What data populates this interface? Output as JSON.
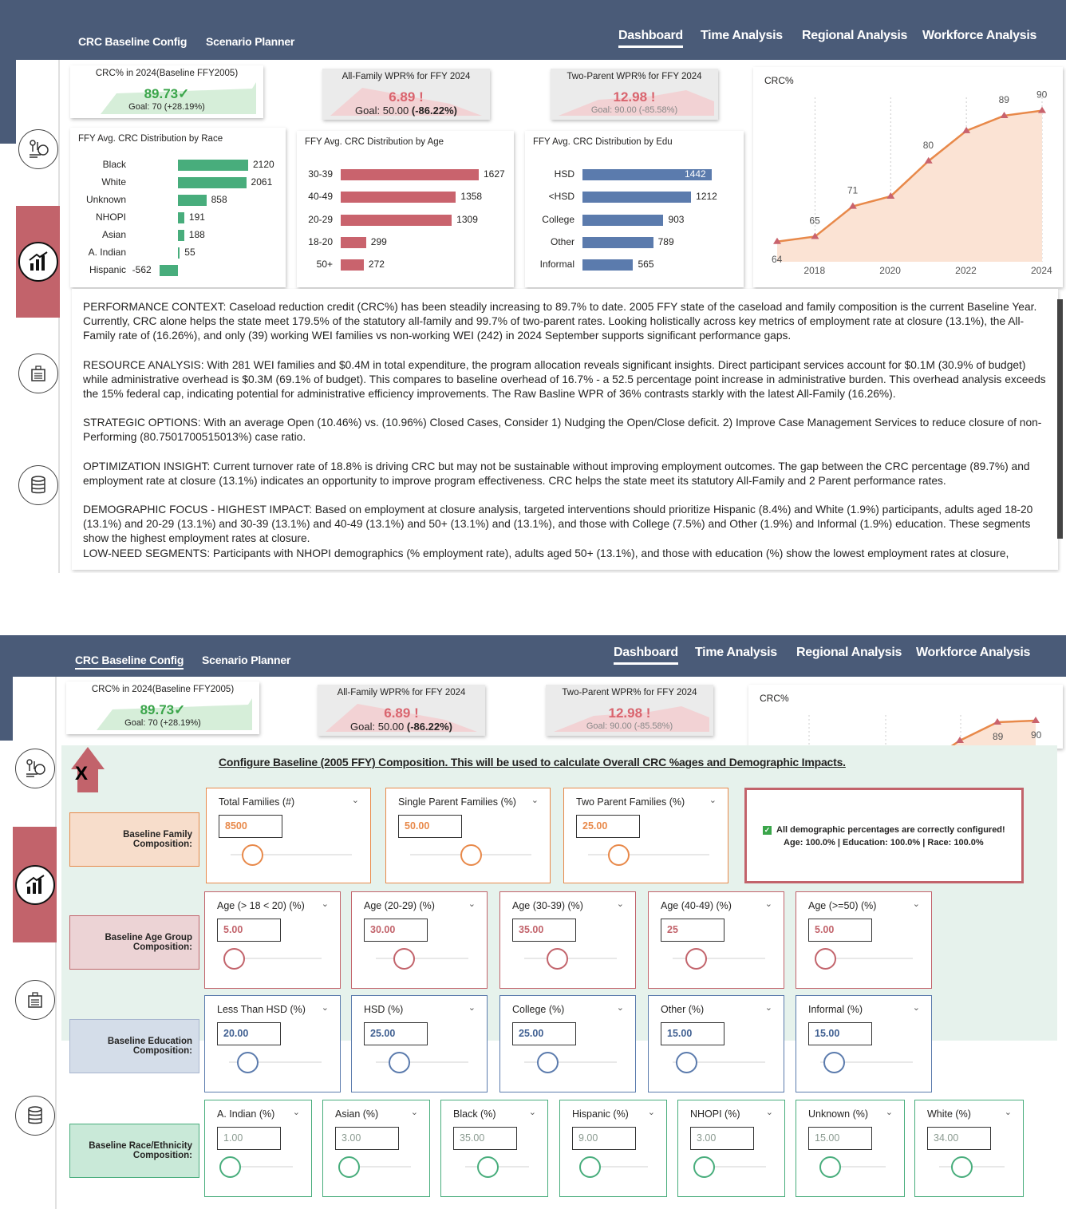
{
  "nav": {
    "config": "CRC Baseline Config",
    "planner": "Scenario Planner",
    "dashboard": "Dashboard",
    "time": "Time Analysis",
    "regional": "Regional Analysis",
    "workforce": "Workforce Analysis"
  },
  "kpis": {
    "crc": {
      "title": "CRC% in 2024(Baseline FFY2005)",
      "value": "89.73",
      "goal": "Goal: 70 (+28.19%)",
      "color": "#3aa54a"
    },
    "all_family": {
      "title": "All-Family WPR% for FFY 2024",
      "value": "6.89",
      "goal_prefix": "Goal: 50.00 ",
      "goal_delta": "(-86.22%)",
      "color": "#d9646e"
    },
    "two_parent": {
      "title": "Two-Parent WPR% for FFY 2024",
      "value": "12.98",
      "goal": "Goal: 90.00 (-85.58%)",
      "color": "#d9646e"
    }
  },
  "race_chart": {
    "title": "FFY Avg. CRC Distribution by Race",
    "rows": [
      {
        "label": "Black",
        "value": 2120
      },
      {
        "label": "White",
        "value": 2061
      },
      {
        "label": "Unknown",
        "value": 858
      },
      {
        "label": "NHOPI",
        "value": 191
      },
      {
        "label": "Asian",
        "value": 188
      },
      {
        "label": "A. Indian",
        "value": 55
      },
      {
        "label": "Hispanic",
        "value": -562
      }
    ],
    "color": "#48ad7c"
  },
  "age_chart": {
    "title": "FFY Avg. CRC Distribution by Age",
    "rows": [
      {
        "label": "30-39",
        "value": 1627
      },
      {
        "label": "40-49",
        "value": 1358
      },
      {
        "label": "20-29",
        "value": 1309
      },
      {
        "label": "18-20",
        "value": 299
      },
      {
        "label": "50+",
        "value": 272
      }
    ],
    "color": "#c9636d"
  },
  "edu_chart": {
    "title": "FFY Avg. CRC Distribution by Edu",
    "rows": [
      {
        "label": "HSD",
        "value": 1442
      },
      {
        "label": "<HSD",
        "value": 1212
      },
      {
        "label": "College",
        "value": 903
      },
      {
        "label": "Other",
        "value": 789
      },
      {
        "label": "Informal",
        "value": 565
      }
    ],
    "color": "#5b7bad"
  },
  "chart_data": {
    "type": "area",
    "title": "CRC%",
    "x": [
      2017,
      2018,
      2019,
      2020,
      2021,
      2022,
      2023,
      2024
    ],
    "values": [
      64,
      65,
      71,
      73,
      80,
      86,
      89,
      90
    ],
    "labels": [
      "64",
      "65",
      "71",
      "",
      "80",
      "",
      "89",
      "90"
    ],
    "x_ticks": [
      "2018",
      "2020",
      "2022",
      "2024"
    ],
    "ylim": [
      60,
      92
    ],
    "line_color": "#e8894a",
    "fill_color": "#fbe3d4",
    "marker_color": "#c9636d"
  },
  "summary": {
    "p1": "PERFORMANCE CONTEXT: Caseload reduction credit (CRC%) has been steadily increasing to 89.7% to date. 2005 FFY state of the caseload and family composition is the current Baseline Year. Currently, CRC alone helps the state meet 179.5% of the statutory all-family and 99.7% of two-parent rates. Looking holistically across key metrics of employment rate at closure (13.1%), the All-Family rate of (16.26%), and only (39) working WEI families vs non-working WEI (242) in 2024 September supports significant performance gaps.",
    "p2": "RESOURCE ANALYSIS: With 281 WEI families and $0.4M in total expenditure, the program allocation reveals significant insights. Direct participant services account for $0.1M (30.9% of budget) while administrative overhead is $0.3M (69.1% of budget). This compares to baseline overhead of 16.7% - a 52.5 percentage point increase in administrative burden. This overhead analysis exceeds the 15% federal cap, indicating potential for administrative efficiency improvements. The Raw Basline WPR of 36% contrasts starkly with the latest All-Family (16.26%).",
    "p3": "STRATEGIC OPTIONS: With an average Open (10.46%) vs. (10.96%) Closed Cases, Consider 1) Nudging the Open/Close deficit. 2) Improve Case Management Services to reduce closure of non-Performing (80.7501700515013%) case ratio.",
    "p4": "OPTIMIZATION INSIGHT: Current turnover rate of 18.8% is driving CRC but may not be sustainable without improving employment outcomes. The gap between the CRC percentage (89.7%) and employment rate at closure (13.1%) indicates an opportunity to improve program effectiveness. CRC helps the state meet its statutory All-Family and 2 Parent performance rates.",
    "p5": "DEMOGRAPHIC FOCUS - HIGHEST IMPACT: Based on employment at closure analysis, targeted interventions should prioritize Hispanic (8.4%) and White (1.9%) participants, adults aged 18-20 (13.1%) and 20-29 (13.1%) and 30-39 (13.1%) and 40-49 (13.1%) and 50+ (13.1%) and  (13.1%), and those with College (7.5%) and Other (1.9%) and Informal (1.9%) education. These segments show the highest employment rates at closure.",
    "p6": "LOW-NEED SEGMENTS: Participants with NHOPI demographics (% employment rate), adults aged 50+ (13.1%), and those with  education (%) show the lowest employment rates at closure,"
  },
  "config": {
    "title": "Configure Baseline (2005 FFY) Composition. This will be used to calculate Overall CRC %ages and Demographic Impacts.",
    "close": "X",
    "status_line1": "All demographic percentages are correctly configured!",
    "status_line2": "Age: 100.0% | Education: 100.0% | Race: 100.0%",
    "family": {
      "label1": "Baseline Family",
      "label2": "Composition:",
      "fields": [
        {
          "label": "Total Families (#)",
          "value": "8500",
          "level": 0.18
        },
        {
          "label": "Single Parent Families (%)",
          "value": "50.00",
          "level": 0.5
        },
        {
          "label": "Two Parent Families (%)",
          "value": "25.00",
          "level": 0.25
        }
      ]
    },
    "age": {
      "label1": "Baseline Age Group",
      "label2": "Composition:",
      "fields": [
        {
          "label": "Age (> 18 < 20) (%)",
          "value": "5.00",
          "level": 0.05
        },
        {
          "label": "Age (20-29) (%)",
          "value": "30.00",
          "level": 0.3
        },
        {
          "label": "Age (30-39) (%)",
          "value": "35.00",
          "level": 0.35
        },
        {
          "label": "Age (40-49) (%)",
          "value": "25",
          "level": 0.25
        },
        {
          "label": "Age (>=50) (%)",
          "value": "5.00",
          "level": 0.05
        }
      ]
    },
    "edu": {
      "label1": "Baseline Education",
      "label2": "Composition:",
      "fields": [
        {
          "label": "Less Than HSD (%)",
          "value": "20.00",
          "level": 0.2
        },
        {
          "label": "HSD (%)",
          "value": "25.00",
          "level": 0.25
        },
        {
          "label": "College (%)",
          "value": "25.00",
          "level": 0.25
        },
        {
          "label": "Other (%)",
          "value": "15.00",
          "level": 0.15
        },
        {
          "label": "Informal (%)",
          "value": "15.00",
          "level": 0.15
        }
      ]
    },
    "race": {
      "label1": "Baseline Race/Ethnicity",
      "label2": "Composition:",
      "fields": [
        {
          "label": "A. Indian (%)",
          "value": "1.00",
          "level": 0.01
        },
        {
          "label": "Asian (%)",
          "value": "3.00",
          "level": 0.03
        },
        {
          "label": "Black (%)",
          "value": "35.00",
          "level": 0.35
        },
        {
          "label": "Hispanic (%)",
          "value": "9.00",
          "level": 0.09
        },
        {
          "label": "NHOPI (%)",
          "value": "3.00",
          "level": 0.03
        },
        {
          "label": "Unknown (%)",
          "value": "15.00",
          "level": 0.15
        },
        {
          "label": "White (%)",
          "value": "34.00",
          "level": 0.34
        }
      ]
    }
  },
  "mini_chart_labels": [
    "89",
    "90"
  ]
}
